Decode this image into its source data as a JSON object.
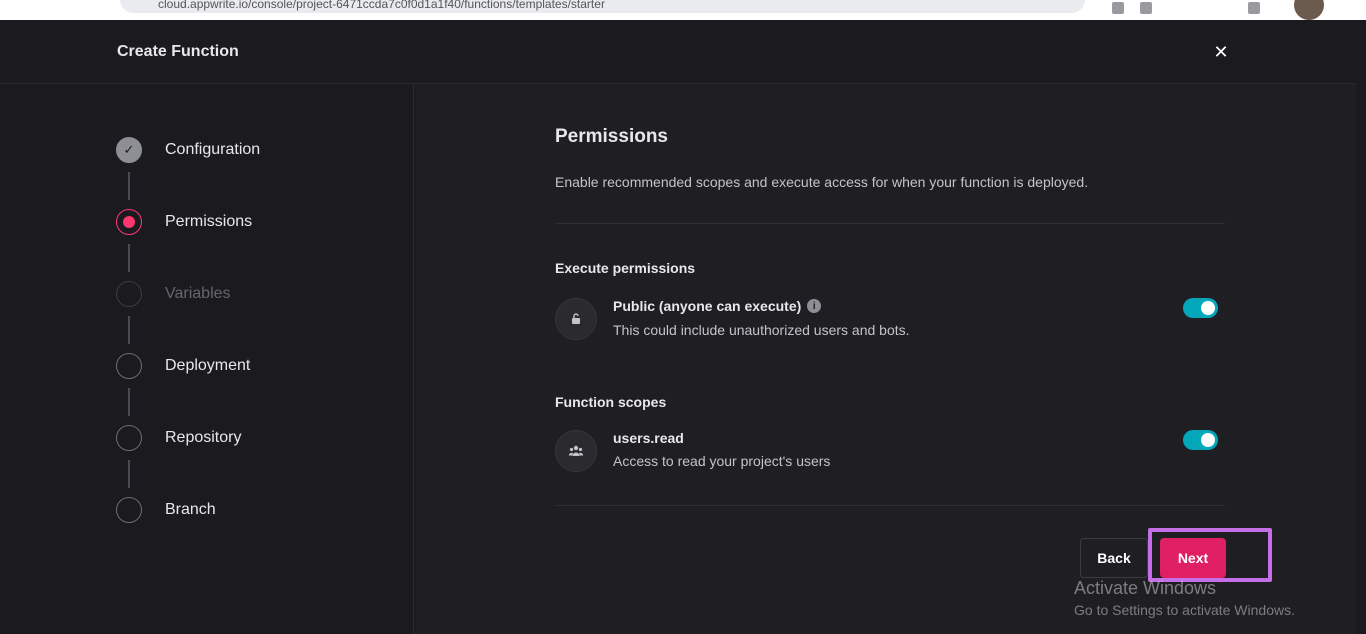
{
  "browser": {
    "url": "cloud.appwrite.io/console/project-6471ccda7c0f0d1a1f40/functions/templates/starter"
  },
  "modal": {
    "title": "Create Function",
    "close_icon": "close-icon"
  },
  "steps": [
    {
      "label": "Configuration",
      "state": "done"
    },
    {
      "label": "Permissions",
      "state": "active"
    },
    {
      "label": "Variables",
      "state": "disabled"
    },
    {
      "label": "Deployment",
      "state": "pending"
    },
    {
      "label": "Repository",
      "state": "pending"
    },
    {
      "label": "Branch",
      "state": "pending"
    }
  ],
  "permissions": {
    "title": "Permissions",
    "description": "Enable recommended scopes and execute access for when your function is deployed.",
    "execute": {
      "heading": "Execute permissions",
      "icon": "lock-open-icon",
      "title": "Public (anyone can execute)",
      "info": "i",
      "description": "This could include unauthorized users and bots.",
      "enabled": true
    },
    "scopes": {
      "heading": "Function scopes",
      "icon": "users-icon",
      "title": "users.read",
      "description": "Access to read your project's users",
      "enabled": true
    }
  },
  "footer": {
    "back_label": "Back",
    "next_label": "Next"
  },
  "watermark": {
    "line1": "Activate Windows",
    "line2": "Go to Settings to activate Windows."
  },
  "colors": {
    "accent": "#fd366e",
    "next_button": "#e01f62",
    "toggle_on": "#02a7b9",
    "highlight": "#c46ee8"
  }
}
